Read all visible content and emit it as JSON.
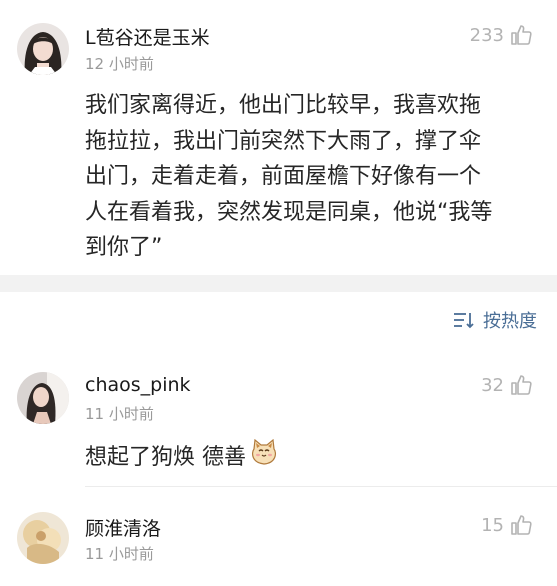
{
  "post": {
    "username": "L苞谷还是玉米",
    "time": "12 小时前",
    "likes": "233",
    "content_lines": [
      "我们家离得近，他出门比较早，我喜欢拖",
      "拖拉拉，我出门前突然下大雨了，撑了伞",
      "出门，走着走着，前面屋檐下好像有一个",
      "人在看着我，突然发现是同桌，他说“我等",
      "到你了”"
    ]
  },
  "sort": {
    "label": "按热度",
    "icon": "sort-icon"
  },
  "comments": [
    {
      "username": "chaos_pink",
      "time": "11 小时前",
      "likes": "32",
      "text": "想起了狗焕 德善",
      "emoji": "cat-face-emoji"
    },
    {
      "username": "顾淮清洛",
      "time": "11 小时前",
      "likes": "15",
      "text": ""
    }
  ],
  "colors": {
    "accent": "#4a6e96",
    "muted": "#9a9a9a",
    "divider": "#f2f2f2"
  }
}
